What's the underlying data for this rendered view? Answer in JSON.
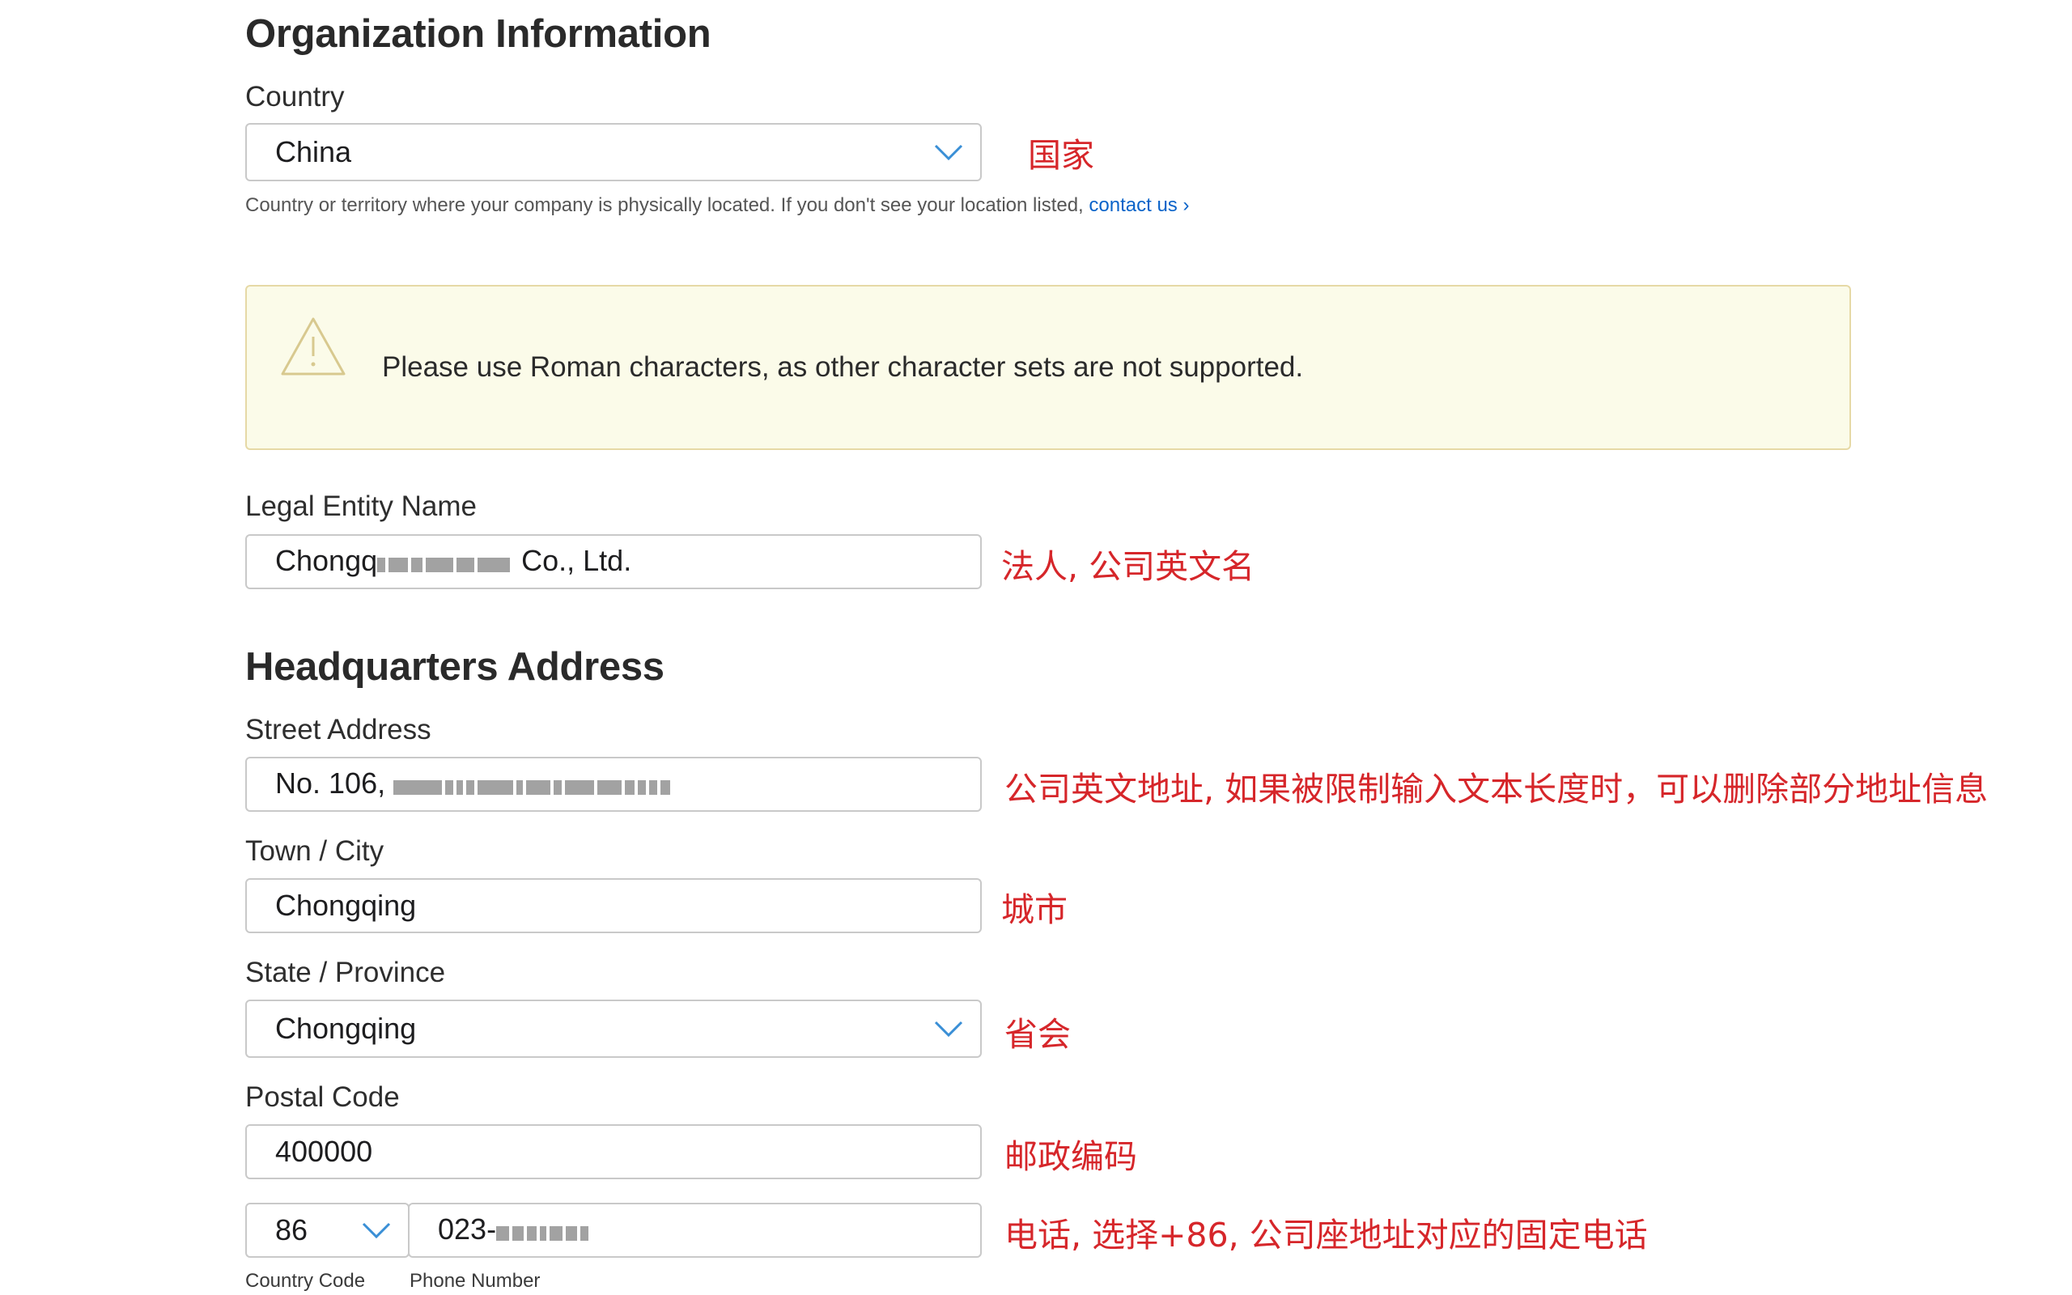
{
  "sections": {
    "org_title": "Organization Information",
    "hq_title": "Headquarters Address"
  },
  "country": {
    "label": "Country",
    "value": "China",
    "help_text": "Country or territory where your company is physically located. If you don't see your location listed,",
    "help_link": "contact us",
    "help_chevron": "›",
    "annotation": "国家"
  },
  "warning": {
    "icon": "warning-triangle-icon",
    "text": "Please use Roman characters, as other character sets are not supported."
  },
  "legal_entity": {
    "label": "Legal Entity Name",
    "value_prefix": "Chongq",
    "value_suffix": "Co., Ltd.",
    "annotation": "法人, 公司英文名"
  },
  "street": {
    "label": "Street Address",
    "value_prefix": "No. 106,",
    "annotation": "公司英文地址, 如果被限制输入文本长度时，可以删除部分地址信息"
  },
  "city": {
    "label": "Town / City",
    "value": "Chongqing",
    "annotation": "城市"
  },
  "state": {
    "label": "State / Province",
    "value": "Chongqing",
    "annotation": "省会"
  },
  "postal": {
    "label": "Postal Code",
    "value": "400000",
    "annotation": "邮政编码"
  },
  "phone": {
    "country_code": "86",
    "number_prefix": "023-",
    "country_code_label": "Country Code",
    "number_label": "Phone Number",
    "annotation": "电话, 选择+86, 公司座地址对应的固定电话"
  },
  "colors": {
    "annotation_red": "#d6262a",
    "link_blue": "#0a63c9",
    "chevron_blue": "#3a8fd6",
    "warning_bg": "#fbfbe9"
  }
}
